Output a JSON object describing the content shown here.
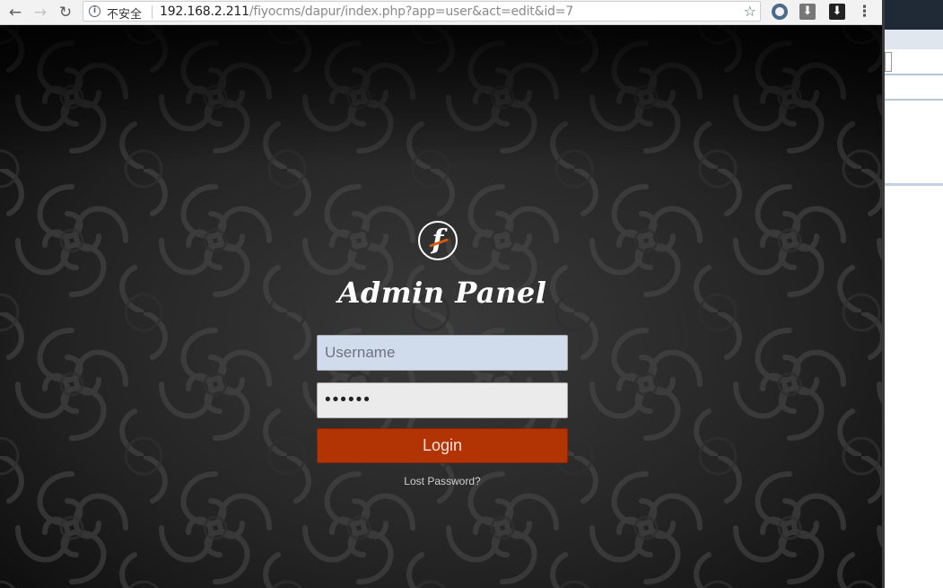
{
  "browser": {
    "security_label": "不安全",
    "url_host": "192.168.2.211",
    "url_path": "/fiyocms/dapur/index.php?app=user&act=edit&id=7",
    "icons": {
      "back": "arrow-left-icon",
      "forward": "arrow-right-icon",
      "reload": "reload-icon",
      "info": "info-icon",
      "bookmark": "star-icon",
      "menu": "kebab-menu-icon"
    }
  },
  "login": {
    "logo_letter": "f",
    "title": "Admin Panel",
    "username_placeholder": "Username",
    "password_value": "••••••",
    "login_label": "Login",
    "lost_password": "Lost Password?"
  },
  "colors": {
    "login_button": "#b23304",
    "username_bg": "#d0dceb",
    "logo_accent": "#d65a10"
  }
}
